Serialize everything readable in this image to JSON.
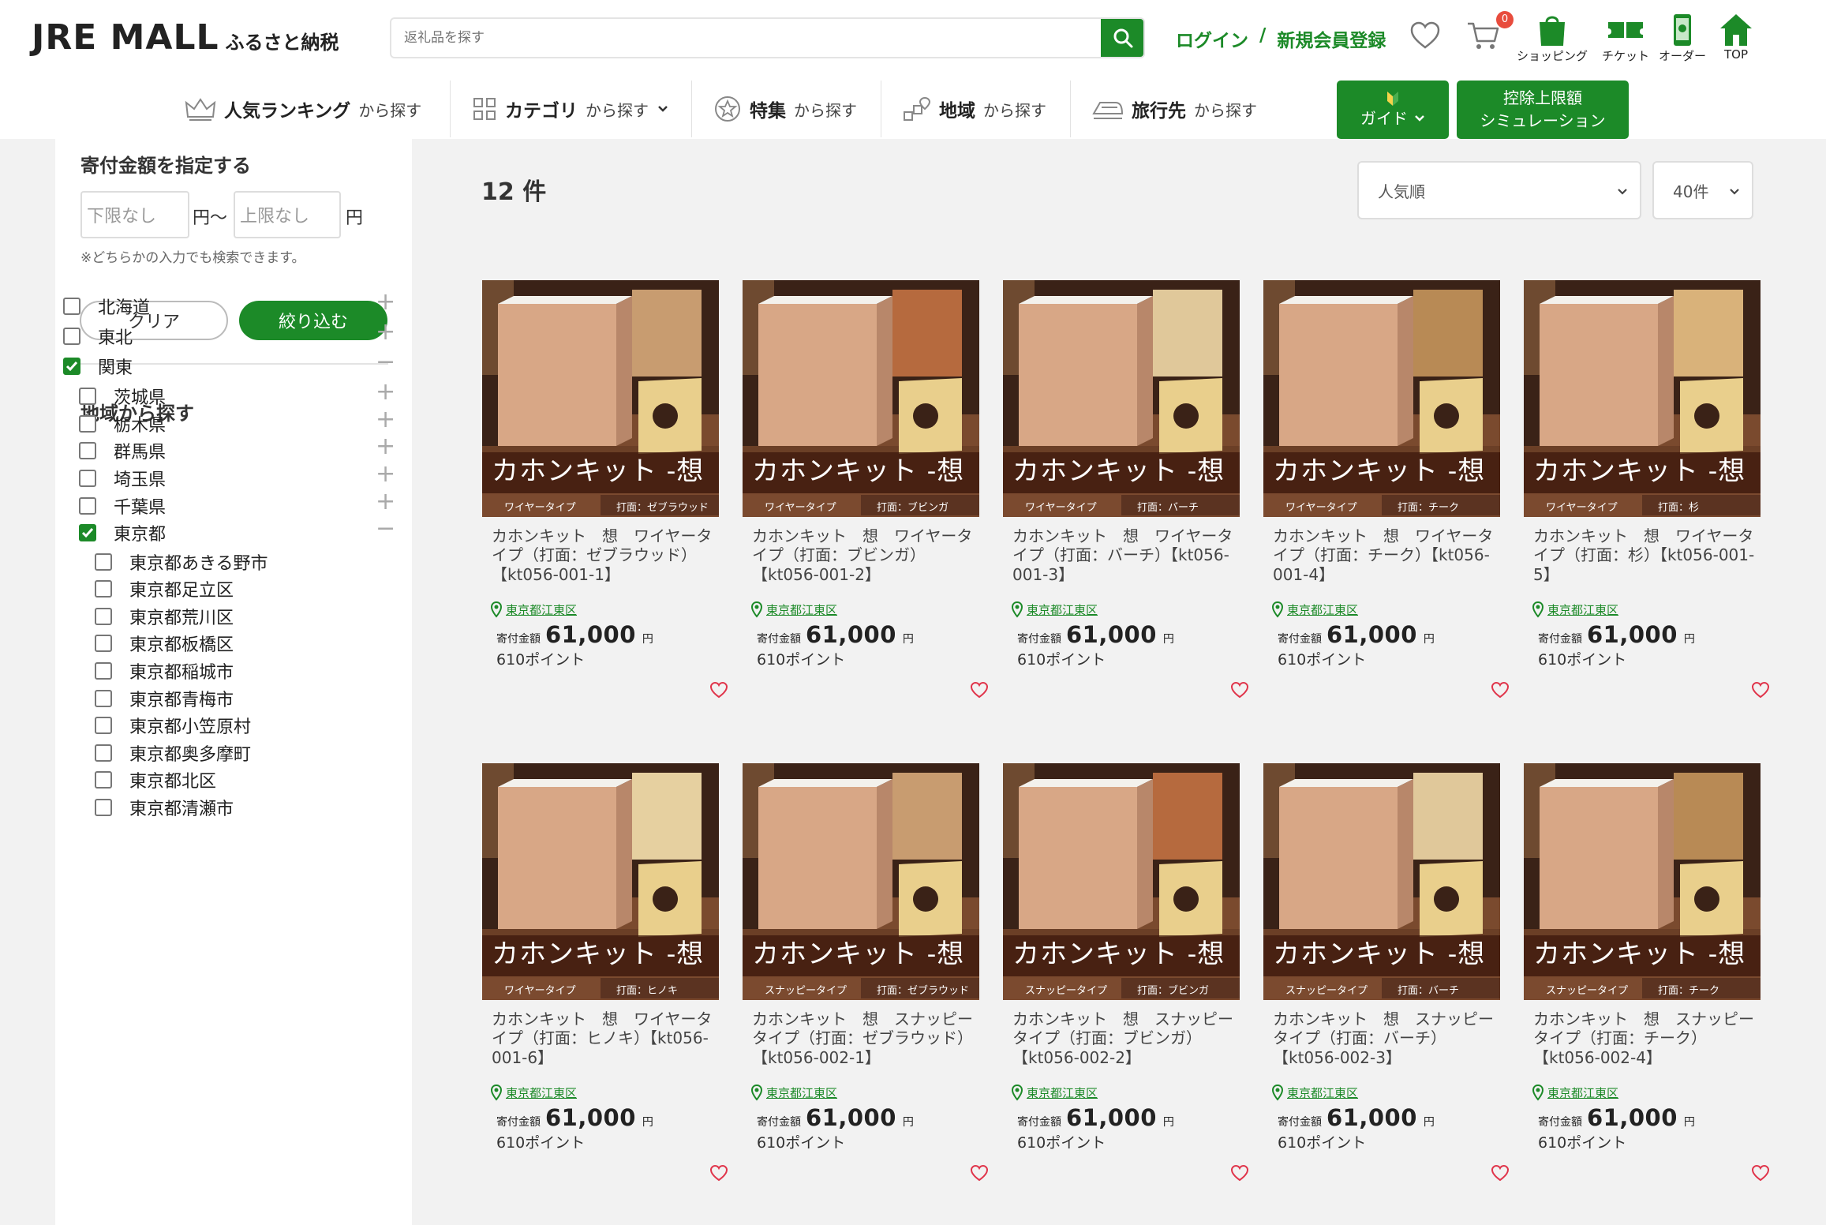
{
  "header": {
    "logo_main": "JRE MALL",
    "logo_sub": "ふるさと納税",
    "search_placeholder": "返礼品を探す",
    "login": "ログイン",
    "slash": "/",
    "register": "新規会員登録",
    "cart_count": "0",
    "icons": [
      {
        "label": "ショッピング",
        "icon": "shopping-bag-icon"
      },
      {
        "label": "チケット",
        "icon": "ticket-icon"
      },
      {
        "label": "オーダー",
        "icon": "phone-order-icon"
      },
      {
        "label": "TOP",
        "icon": "home-icon"
      }
    ]
  },
  "nav": {
    "items": [
      {
        "bold": "人気ランキング",
        "light": "から探す",
        "icon": "crown-icon"
      },
      {
        "bold": "カテゴリ",
        "light": "から探す",
        "icon": "grid-icon"
      },
      {
        "bold": "特集",
        "light": "から探す",
        "icon": "star-badge-icon"
      },
      {
        "bold": "地域",
        "light": "から探す",
        "icon": "map-pin-icon"
      },
      {
        "bold": "旅行先",
        "light": "から探す",
        "icon": "train-icon"
      }
    ],
    "guide_label": "ガイド",
    "sim_label_1": "控除上限額",
    "sim_label_2": "シミュレーション"
  },
  "sidebar": {
    "amount_title": "寄付金額を指定する",
    "min_placeholder": "下限なし",
    "max_placeholder": "上限なし",
    "yen_from": "円〜",
    "yen": "円",
    "note": "※どちらかの入力でも検索できます。",
    "clear": "クリア",
    "apply": "絞り込む",
    "region_title": "地域から探す",
    "regions": [
      {
        "label": "北海道",
        "checked": false,
        "level": 0,
        "sign": "+"
      },
      {
        "label": "東北",
        "checked": false,
        "level": 0,
        "sign": "+"
      },
      {
        "label": "関東",
        "checked": true,
        "level": 0,
        "sign": "−"
      },
      {
        "label": "茨城県",
        "checked": false,
        "level": 1,
        "sign": "+"
      },
      {
        "label": "栃木県",
        "checked": false,
        "level": 1,
        "sign": "+"
      },
      {
        "label": "群馬県",
        "checked": false,
        "level": 1,
        "sign": "+"
      },
      {
        "label": "埼玉県",
        "checked": false,
        "level": 1,
        "sign": "+"
      },
      {
        "label": "千葉県",
        "checked": false,
        "level": 1,
        "sign": "+"
      },
      {
        "label": "東京都",
        "checked": true,
        "level": 1,
        "sign": "−"
      },
      {
        "label": "東京都あきる野市",
        "checked": false,
        "level": 2,
        "sign": ""
      },
      {
        "label": "東京都足立区",
        "checked": false,
        "level": 2,
        "sign": ""
      },
      {
        "label": "東京都荒川区",
        "checked": false,
        "level": 2,
        "sign": ""
      },
      {
        "label": "東京都板橋区",
        "checked": false,
        "level": 2,
        "sign": ""
      },
      {
        "label": "東京都稲城市",
        "checked": false,
        "level": 2,
        "sign": ""
      },
      {
        "label": "東京都青梅市",
        "checked": false,
        "level": 2,
        "sign": ""
      },
      {
        "label": "東京都小笠原村",
        "checked": false,
        "level": 2,
        "sign": ""
      },
      {
        "label": "東京都奥多摩町",
        "checked": false,
        "level": 2,
        "sign": ""
      },
      {
        "label": "東京都北区",
        "checked": false,
        "level": 2,
        "sign": ""
      },
      {
        "label": "東京都清瀬市",
        "checked": false,
        "level": 2,
        "sign": ""
      }
    ]
  },
  "main": {
    "count": "12 件",
    "sort_value": "人気順",
    "per_page_value": "40件"
  },
  "products": [
    {
      "title": "カホンキット　想　ワイヤータイプ（打面：ゼブラウッド）【kt056-001-1】",
      "location": "東京都江東区",
      "price_label": "寄付金額",
      "price": "61,000",
      "yen": "円",
      "points": "610ポイント",
      "banner_title": "カホンキット -想",
      "type_tag": "ワイヤータイプ",
      "face_tag": "打面：ゼブラウッド"
    },
    {
      "title": "カホンキット　想　ワイヤータイプ（打面：ブビンガ）【kt056-001-2】",
      "location": "東京都江東区",
      "price_label": "寄付金額",
      "price": "61,000",
      "yen": "円",
      "points": "610ポイント",
      "banner_title": "カホンキット -想",
      "type_tag": "ワイヤータイプ",
      "face_tag": "打面：ブビンガ"
    },
    {
      "title": "カホンキット　想　ワイヤータイプ（打面：バーチ）【kt056-001-3】",
      "location": "東京都江東区",
      "price_label": "寄付金額",
      "price": "61,000",
      "yen": "円",
      "points": "610ポイント",
      "banner_title": "カホンキット -想",
      "type_tag": "ワイヤータイプ",
      "face_tag": "打面：バーチ"
    },
    {
      "title": "カホンキット　想　ワイヤータイプ（打面：チーク）【kt056-001-4】",
      "location": "東京都江東区",
      "price_label": "寄付金額",
      "price": "61,000",
      "yen": "円",
      "points": "610ポイント",
      "banner_title": "カホンキット -想",
      "type_tag": "ワイヤータイプ",
      "face_tag": "打面：チーク"
    },
    {
      "title": "カホンキット　想　ワイヤータイプ（打面：杉）【kt056-001-5】",
      "location": "東京都江東区",
      "price_label": "寄付金額",
      "price": "61,000",
      "yen": "円",
      "points": "610ポイント",
      "banner_title": "カホンキット -想",
      "type_tag": "ワイヤータイプ",
      "face_tag": "打面：杉"
    },
    {
      "title": "カホンキット　想　ワイヤータイプ（打面：ヒノキ）【kt056-001-6】",
      "location": "東京都江東区",
      "price_label": "寄付金額",
      "price": "61,000",
      "yen": "円",
      "points": "610ポイント",
      "banner_title": "カホンキット -想",
      "type_tag": "ワイヤータイプ",
      "face_tag": "打面：ヒノキ"
    },
    {
      "title": "カホンキット　想　スナッピータイプ（打面：ゼブラウッド）【kt056-002-1】",
      "location": "東京都江東区",
      "price_label": "寄付金額",
      "price": "61,000",
      "yen": "円",
      "points": "610ポイント",
      "banner_title": "カホンキット -想",
      "type_tag": "スナッピータイプ",
      "face_tag": "打面：ゼブラウッド"
    },
    {
      "title": "カホンキット　想　スナッピータイプ（打面：ブビンガ）【kt056-002-2】",
      "location": "東京都江東区",
      "price_label": "寄付金額",
      "price": "61,000",
      "yen": "円",
      "points": "610ポイント",
      "banner_title": "カホンキット -想",
      "type_tag": "スナッピータイプ",
      "face_tag": "打面：ブビンガ"
    },
    {
      "title": "カホンキット　想　スナッピータイプ（打面：バーチ）【kt056-002-3】",
      "location": "東京都江東区",
      "price_label": "寄付金額",
      "price": "61,000",
      "yen": "円",
      "points": "610ポイント",
      "banner_title": "カホンキット -想",
      "type_tag": "スナッピータイプ",
      "face_tag": "打面：バーチ"
    },
    {
      "title": "カホンキット　想　スナッピータイプ（打面：チーク）【kt056-002-4】",
      "location": "東京都江東区",
      "price_label": "寄付金額",
      "price": "61,000",
      "yen": "円",
      "points": "610ポイント",
      "banner_title": "カホンキット -想",
      "type_tag": "スナッピータイプ",
      "face_tag": "打面：チーク"
    }
  ],
  "colors": {
    "brand_green": "#1c8a28",
    "badge_red": "#e84c3d",
    "heart": "#e0344a"
  }
}
